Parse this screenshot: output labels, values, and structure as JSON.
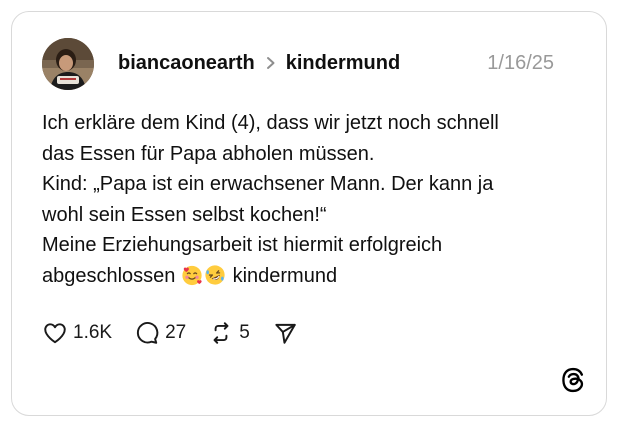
{
  "post": {
    "author": "biancaonearth",
    "community": "kindermund",
    "date": "1/16/25",
    "lines": [
      "Ich erkläre dem Kind (4), dass wir jetzt noch schnell",
      "das Essen für Papa abholen müssen.",
      "Kind: „Papa ist ein erwachsener Mann. Der kann ja",
      "wohl sein Essen selbst kochen!“",
      "Meine Erziehungsarbeit ist hiermit erfolgreich",
      "abgeschlossen",
      "kindermund"
    ],
    "emojis": [
      "smiling-face-with-hearts",
      "rolling-on-floor-laughing"
    ]
  },
  "actions": {
    "likes": "1.6K",
    "replies": "27",
    "reposts": "5"
  },
  "icons": {
    "like": "heart-icon",
    "reply": "comment-bubble-icon",
    "repost": "repost-icon",
    "share": "send-icon",
    "brand": "threads-logo-icon"
  },
  "colors": {
    "text": "#101010",
    "muted": "#999999",
    "border": "#d9d9d9"
  }
}
